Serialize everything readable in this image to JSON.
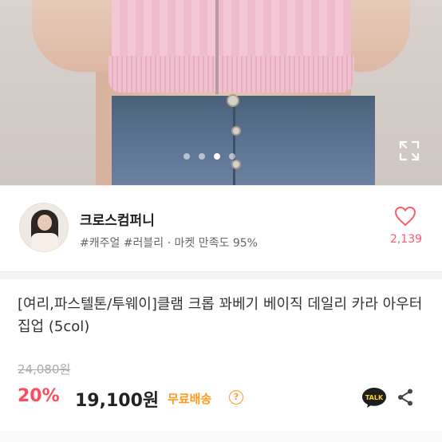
{
  "carousel": {
    "dots": [
      "dot-1",
      "dot-2",
      "dot-3",
      "dot-4"
    ],
    "active_index": 2,
    "expand_icon": "expand-icon"
  },
  "shop": {
    "name": "크로스컴퍼니",
    "tags": "#캐주얼 #러블리 · 마켓 만족도 95%",
    "likes": "2,139",
    "heart_icon": "heart-outline-icon"
  },
  "product": {
    "title": "[여리,파스텔톤/투웨이]클램 크롭 꽈베기 베이직 데일리 카라 아우터 집업 (5col)",
    "original_price": "24,080원",
    "discount": "20%",
    "price": "19,100원",
    "shipping": "무료배송",
    "info_icon": "info-icon",
    "talk_label": "TALK",
    "share_icon": "share-icon"
  },
  "colors": {
    "discount": "#ff4a5e",
    "shipping": "#ff9a1f",
    "likes": "#ff5a6e",
    "talk_bg": "#1e1e1e"
  }
}
